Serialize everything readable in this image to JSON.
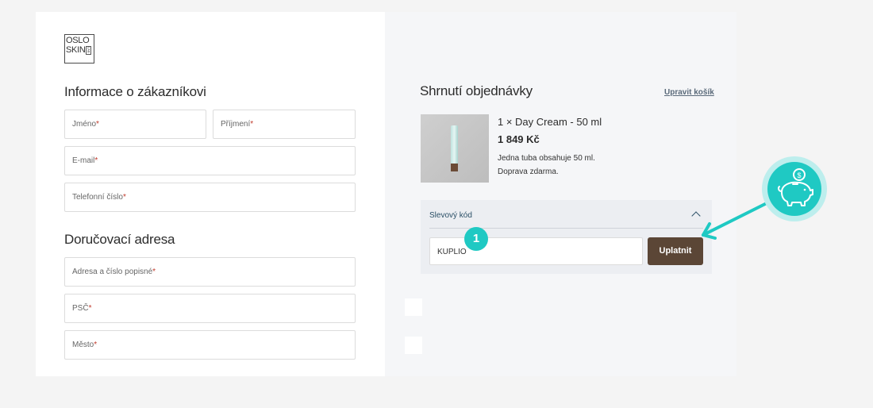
{
  "logo": {
    "line1": "OSLO",
    "line2": "SKIN",
    "lab": "LAB"
  },
  "customer": {
    "title": "Informace o zákazníkovi",
    "first_name": "Jméno",
    "last_name": "Příjmení",
    "email": "E-mail",
    "phone": "Telefonní číslo"
  },
  "delivery": {
    "title": "Doručovací adresa",
    "address": "Adresa a číslo popisné",
    "zip": "PSČ",
    "city": "Město"
  },
  "required_mark": "*",
  "summary": {
    "title": "Shrnutí objednávky",
    "edit_link": "Upravit košík",
    "product": {
      "name": "1 × Day Cream - 50 ml",
      "price": "1 849 Kč",
      "desc1": "Jedna tuba obsahuje 50 ml.",
      "desc2": "Doprava zdarma."
    },
    "discount": {
      "title": "Slevový kód",
      "code_value": "KUPLIO",
      "apply_label": "Uplatnit"
    }
  },
  "annotation": {
    "step_number": "1",
    "icon": "piggy-bank-coin-icon",
    "accent_color": "#1fc9c3"
  }
}
